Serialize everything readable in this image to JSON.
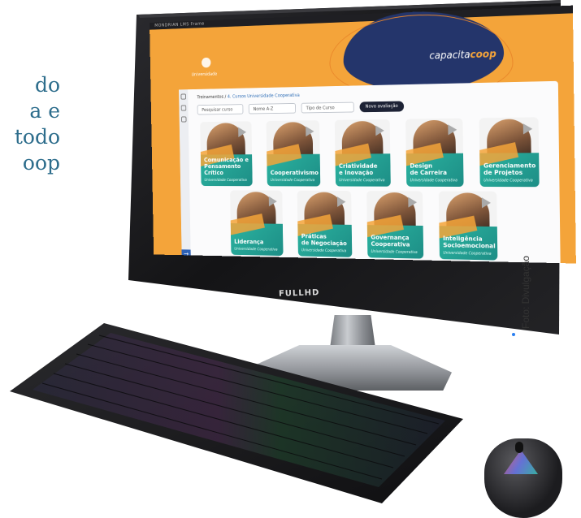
{
  "left_text": {
    "lines": [
      "do",
      "a e",
      "todo",
      "oop"
    ]
  },
  "credit": "Foto: Divulgação",
  "monitor": {
    "brand_label": "FULLHD",
    "power_light_color": "#2a7ff0"
  },
  "screen": {
    "topbar_title": "MONDRIAN LMS Frame",
    "hero_brand": "capacita",
    "hero_brand_suffix": "coop",
    "logo_caption": "Universidade",
    "breadcrumb_home": "Treinamentos",
    "breadcrumb_sep": "/",
    "breadcrumb_current": "4. Cursos Universidade Cooperativa",
    "filters": {
      "search_placeholder": "Pesquisar curso",
      "sort": "Nome A-Z",
      "type": "Tipo de Curso",
      "new_button": "Novo avaliação"
    },
    "cards": [
      {
        "title": "Comunicação e\nPensamento Crítico",
        "subtitle": "Universidade Cooperativa"
      },
      {
        "title": "Cooperativismo",
        "subtitle": "Universidade Cooperativa"
      },
      {
        "title": "Criatividade\ne Inovação",
        "subtitle": "Universidade Cooperativa"
      },
      {
        "title": "Design\nde Carreira",
        "subtitle": "Universidade Cooperativa"
      },
      {
        "title": "Gerenciamento\nde Projetos",
        "subtitle": "Universidade Cooperativa"
      },
      {
        "title": "Liderança",
        "subtitle": "Universidade Cooperativa"
      },
      {
        "title": "Práticas\nde Negociação",
        "subtitle": "Universidade Cooperativa"
      },
      {
        "title": "Governança\nCooperativa",
        "subtitle": "Universidade Cooperativa"
      },
      {
        "title": "Inteligência\nSocioemocional",
        "subtitle": "Universidade Cooperativa"
      }
    ],
    "colors": {
      "orange": "#f4a43a",
      "navy": "#24356b",
      "teal": "#2bb3a0"
    }
  }
}
